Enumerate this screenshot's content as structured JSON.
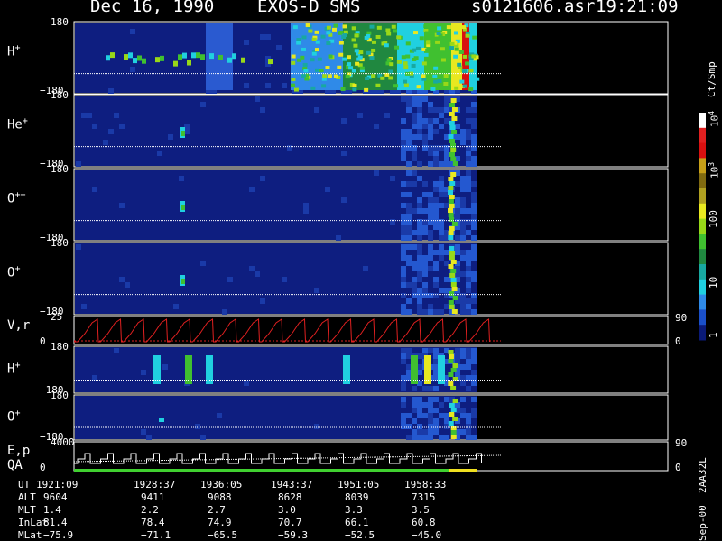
{
  "header": {
    "date": "Dec 16, 1990",
    "instrument": "EXOS-D SMS",
    "file": "s0121606.asr",
    "time": "19:21:09"
  },
  "colorbar": {
    "label": "Ct/Smp",
    "ticks": [
      "1",
      "10",
      "100",
      "10",
      "10"
    ],
    "tick_exponents": [
      "",
      "",
      "",
      "3",
      "4"
    ],
    "colors": [
      "#0a1a78",
      "#1a4fc8",
      "#2f8ae8",
      "#20d0e0",
      "#18a8a0",
      "#208840",
      "#40c030",
      "#98d818",
      "#e8e820",
      "#b0a020",
      "#806a10",
      "#c8a018",
      "#d81010",
      "#e02020",
      "#ffffff"
    ]
  },
  "chart_data": {
    "type": "heatmap",
    "panels": [
      {
        "label": "H",
        "superscript": "+",
        "ymax": "180",
        "ymin": "−180"
      },
      {
        "label": "He",
        "superscript": "+",
        "ymax": "180",
        "ymin": "−180"
      },
      {
        "label": "O",
        "superscript": "++",
        "ymax": "180",
        "ymin": "−180"
      },
      {
        "label": "O",
        "superscript": "+",
        "ymax": "180",
        "ymin": "−180"
      },
      {
        "label": "V,r",
        "superscript": "",
        "ymax": "25",
        "ymin": "0",
        "right_top": "90",
        "right_bottom": "0"
      },
      {
        "label": "H",
        "superscript": "+",
        "ymax": "180",
        "ymin": "−180"
      },
      {
        "label": "O",
        "superscript": "+",
        "ymax": "180",
        "ymin": "−180"
      },
      {
        "label": "E,p",
        "superscript": "",
        "label2": "QA",
        "ymax": "4000",
        "ymin": "0",
        "right_top": "90",
        "right_bottom": "0"
      }
    ],
    "x": [
      0,
      1,
      2,
      3,
      4,
      5,
      6,
      7,
      8,
      9,
      10,
      11,
      12,
      13,
      14,
      15,
      16,
      17,
      18,
      19,
      20,
      21,
      22,
      23,
      24,
      25,
      26,
      27,
      28,
      29,
      30,
      31,
      32,
      33,
      34,
      35,
      36,
      37,
      38
    ],
    "table": {
      "rows": [
        {
          "name": "UT",
          "values": [
            "1921:09",
            "1928:37",
            "1936:05",
            "1943:37",
            "1951:05",
            "1958:33"
          ]
        },
        {
          "name": "ALT",
          "values": [
            "9604",
            "9411",
            "9088",
            "8628",
            "8039",
            "7315"
          ]
        },
        {
          "name": "MLT",
          "values": [
            "1.4",
            "2.2",
            "2.7",
            "3.0",
            "3.3",
            "3.5"
          ]
        },
        {
          "name": "InLat",
          "values": [
            "81.4",
            "78.4",
            "74.9",
            "70.7",
            "66.1",
            "60.8"
          ]
        },
        {
          "name": "MLat",
          "values": [
            "−75.9",
            "−71.1",
            "−65.5",
            "−59.3",
            "−52.5",
            "−45.0"
          ]
        }
      ]
    }
  },
  "footer_vertical": "Sep-00  2AA32L"
}
